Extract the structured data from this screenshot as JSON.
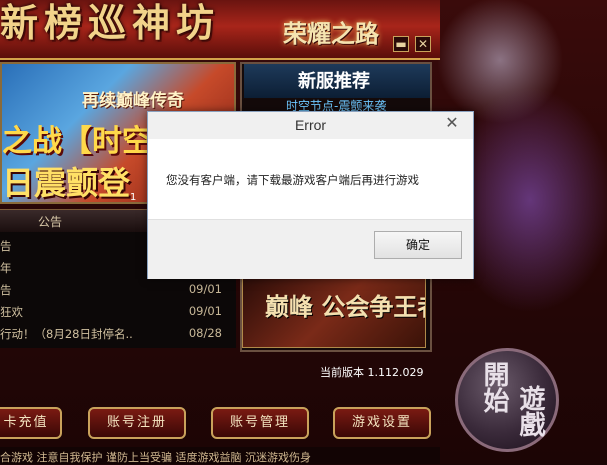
{
  "header": {
    "game_logo": "新榜巡神坊",
    "subtitle": "荣耀之路",
    "minimize_glyph": "▬",
    "close_glyph": "✕"
  },
  "news_banner": {
    "line1": "再续巅峰传奇",
    "line2": "之战【时空",
    "line3": "日震颤登",
    "page_indicator": "1"
  },
  "news_tabs": [
    "公告"
  ],
  "news_items": [
    {
      "title": "告",
      "date": ""
    },
    {
      "title": "年",
      "date": ""
    },
    {
      "title": "告",
      "date": "09/01"
    },
    {
      "title": "狂欢",
      "date": "09/01"
    },
    {
      "title": "行动！（8月28日封停名..",
      "date": "08/28"
    }
  ],
  "server_panel": {
    "title": "新服推荐",
    "subtitle": "时空节点-震颤来袭"
  },
  "promo": {
    "text": "巅峰 公会争王者"
  },
  "version": "当前版本 1.112.029",
  "start_button": {
    "text1": "開始",
    "text2": "遊戲"
  },
  "buttons": {
    "recharge": "卡充值",
    "register": "账号注册",
    "manage": "账号管理",
    "settings": "游戏设置"
  },
  "footer": "合游戏   注意自我保护   谨防上当受骗   适度游戏益脑   沉迷游戏伤身",
  "dialog": {
    "title": "Error",
    "close_glyph": "✕",
    "message": "您没有客户端，请下载最游戏客户端后再进行游戏",
    "ok_label": "确定"
  }
}
